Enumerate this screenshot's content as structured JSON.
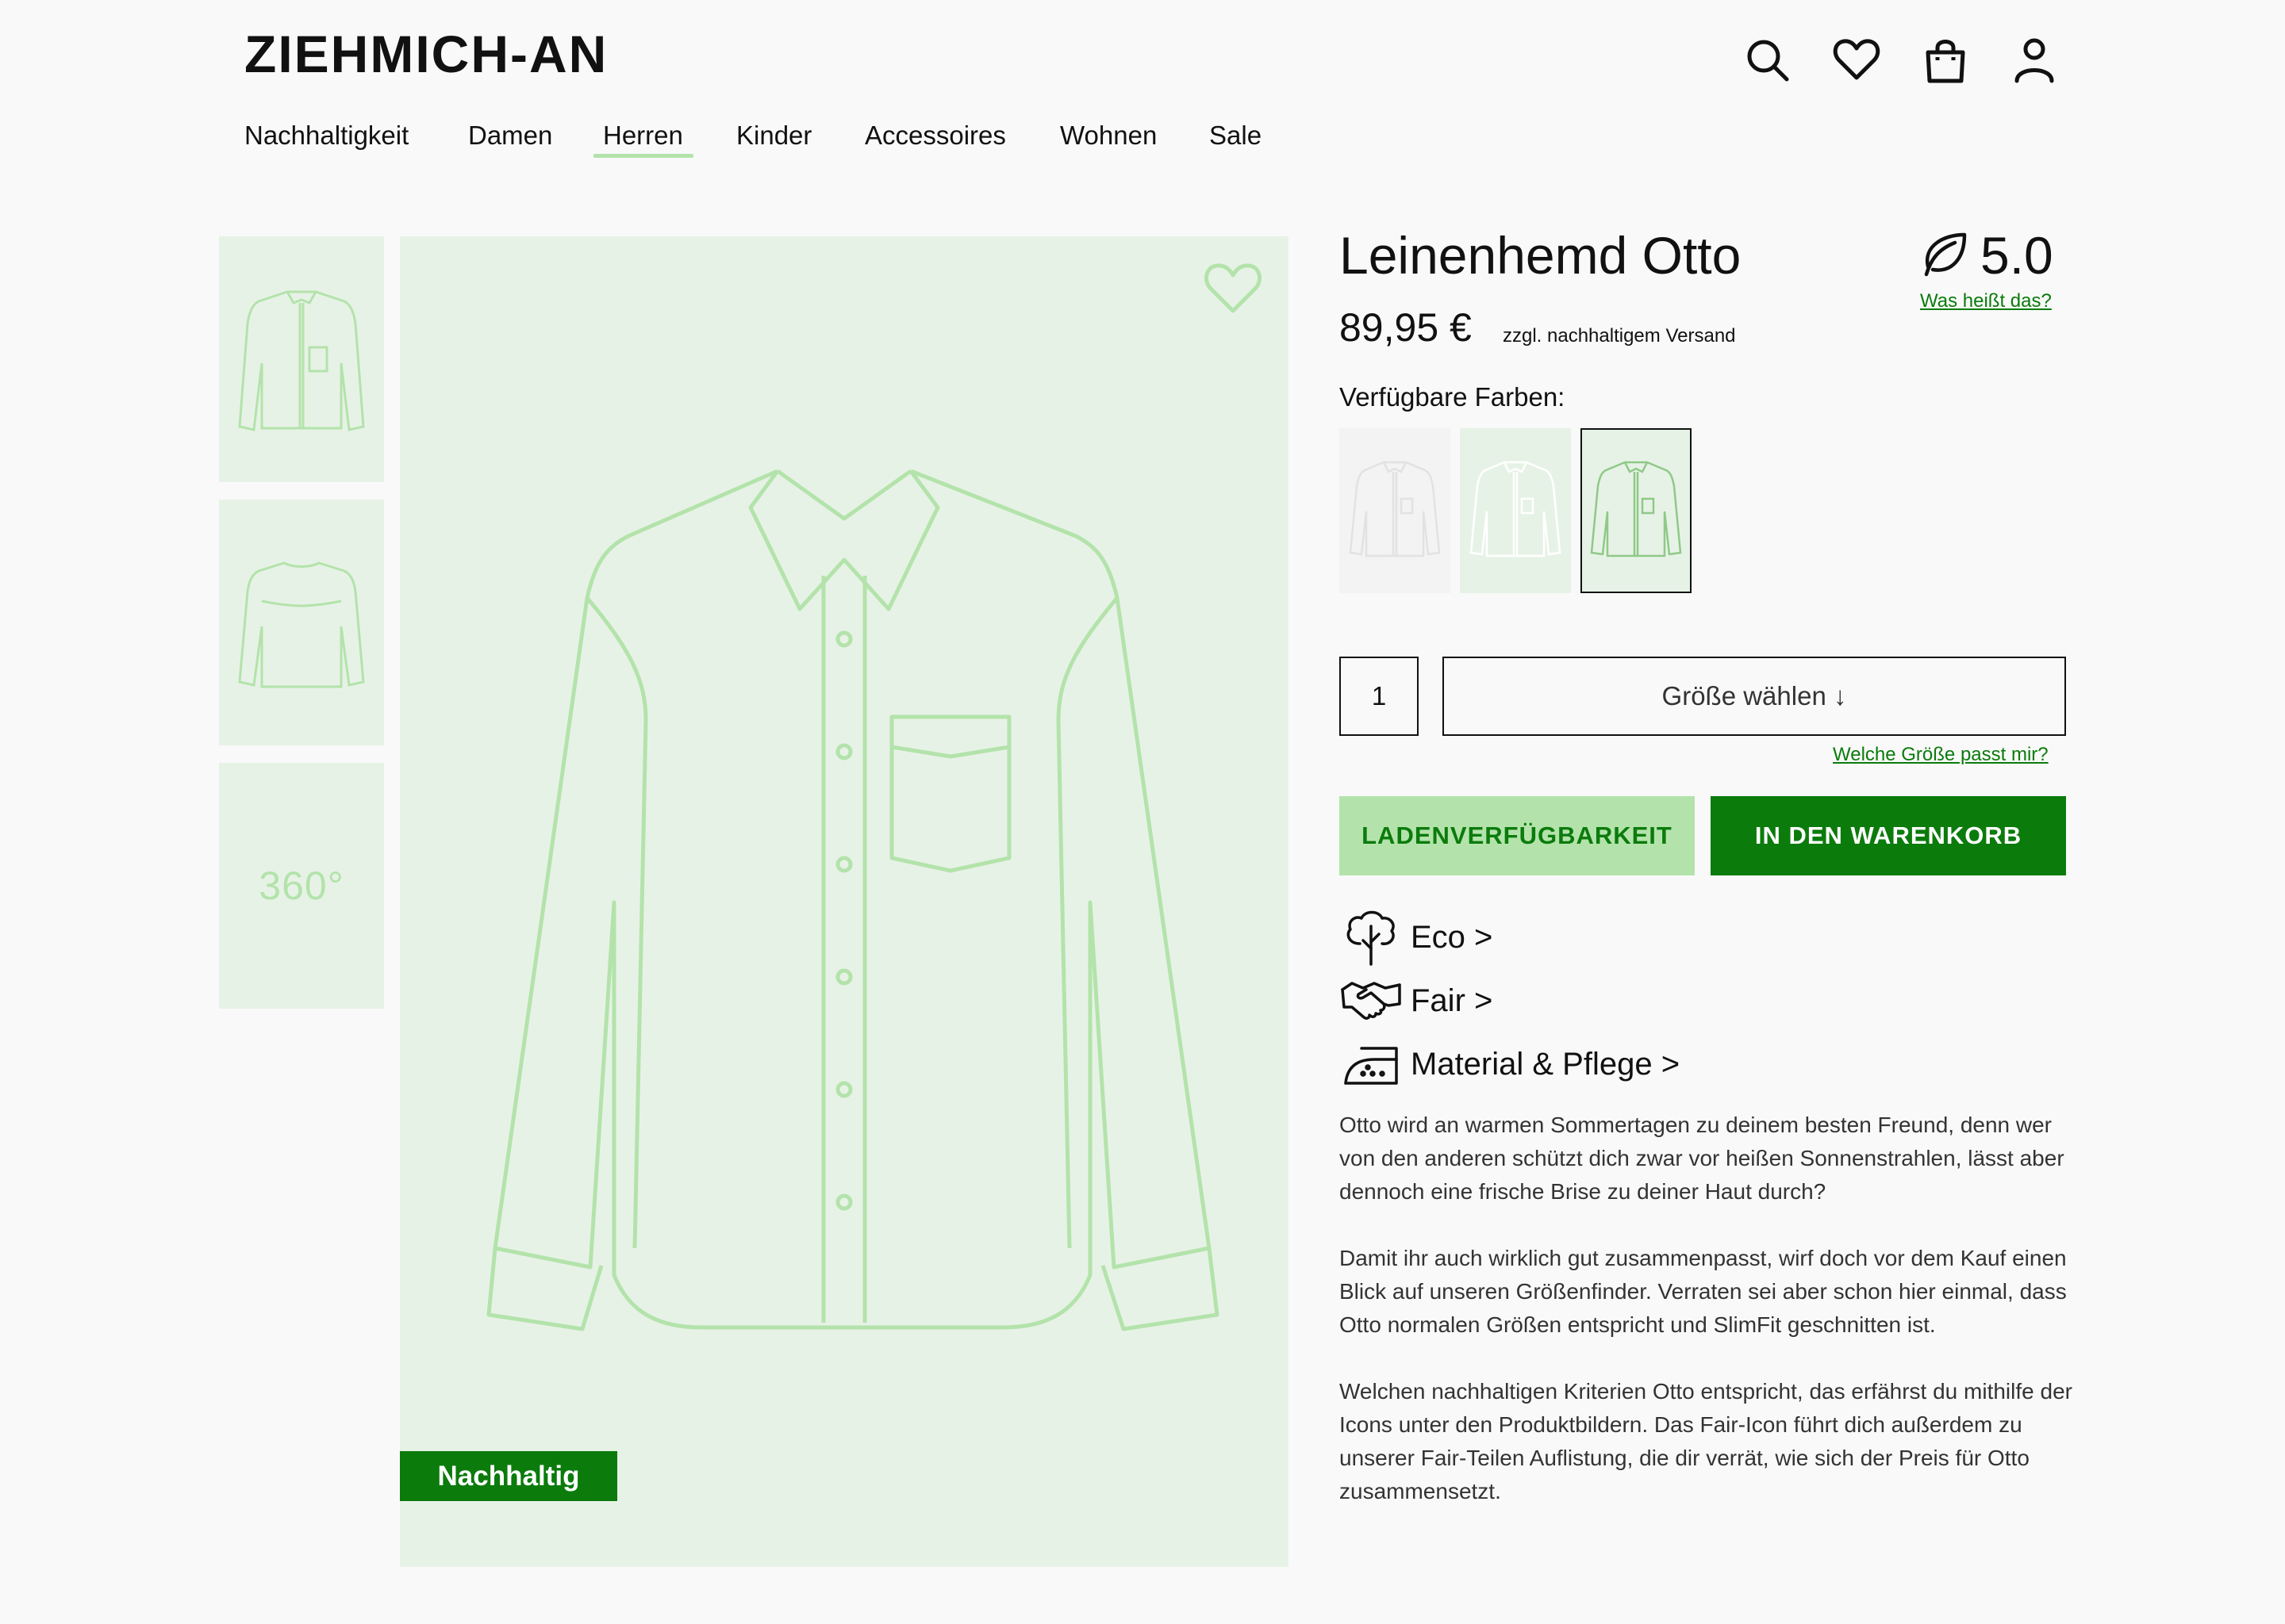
{
  "header": {
    "logo": "ZIEHMICH-AN",
    "nav": [
      "Nachhaltigkeit",
      "Damen",
      "Herren",
      "Kinder",
      "Accessoires",
      "Wohnen",
      "Sale"
    ],
    "active_nav": "Herren"
  },
  "gallery": {
    "thumb_360_label": "360°",
    "badge": "Nachhaltig"
  },
  "product": {
    "title": "Leinenhemd Otto",
    "rating": "5.0",
    "rating_link": "Was heißt das?",
    "price": "89,95 €",
    "shipping": "zzgl. nachhaltigem Versand",
    "colors_label": "Verfügbare Farben:",
    "quantity": "1",
    "size_button": "Größe wählen ↓",
    "size_link": "Welche Größe passt mir?",
    "store_button": "LADENVERFÜGBARKEIT",
    "cart_button": "IN DEN WARENKORB",
    "features": [
      "Eco >",
      "Fair >",
      "Material & Pflege >"
    ],
    "description": [
      "Otto wird an warmen Sommertagen zu deinem besten Freund, denn wer von den anderen schützt dich zwar vor heißen Sonnenstrahlen, lässt aber dennoch eine frische Brise zu deiner Haut durch?",
      "Damit ihr auch wirklich gut zusammenpasst, wirf doch vor dem Kauf einen Blick auf unseren Größenfinder. Verraten sei aber schon hier einmal, dass Otto normalen Größen entspricht und SlimFit geschnitten ist.",
      "Welchen nachhaltigen Kriterien Otto entspricht, das erfährst du mithilfe der Icons unter den Produktbildern. Das Fair-Icon führt dich außerdem zu unserer Fair-Teilen Auflistung, die dir verrät, wie sich der Preis für Otto zusammensetzt."
    ]
  },
  "icons": {
    "header": [
      "search-icon",
      "heart-icon",
      "shopping-bag-icon",
      "user-icon"
    ],
    "features": [
      "tree-icon",
      "handshake-icon",
      "iron-icon"
    ],
    "rating": "leaf-icon"
  },
  "colors": {
    "accent_green": "#0b7b0c",
    "light_green": "#b3e3ab",
    "image_bg": "#e7f2e6",
    "swatch_white": "#f2f3f2",
    "swatch_light_green": "#e7f2e6",
    "swatch_selected": "#e7f2e6"
  }
}
